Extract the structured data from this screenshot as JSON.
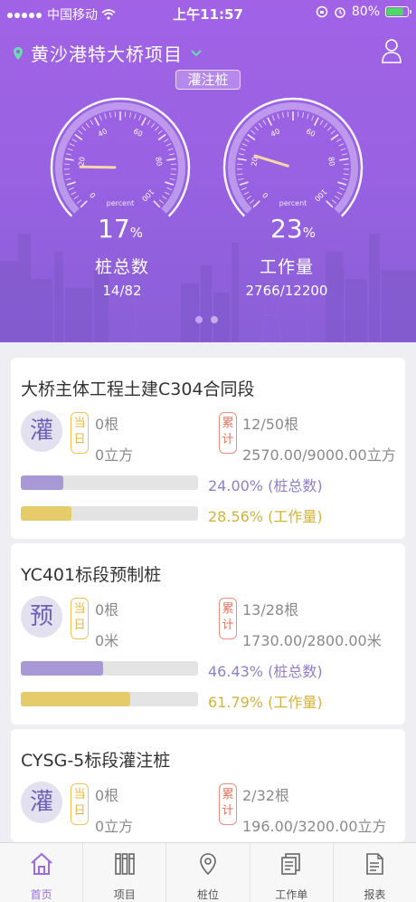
{
  "statusbar": {
    "carrier": "中国移动",
    "time": "上午11:57",
    "battery": "80%"
  },
  "header": {
    "project_title": "黄沙港特大桥项目",
    "mode_tag": "灌注桩"
  },
  "gauges": [
    {
      "percent": "17",
      "unit": "%",
      "label": "percent",
      "name": "桩总数",
      "value": "14/82",
      "fraction": 0.17
    },
    {
      "percent": "23",
      "unit": "%",
      "label": "percent",
      "name": "工作量",
      "value": "2766/12200",
      "fraction": 0.23
    }
  ],
  "gauge_ticks": [
    "0",
    "20",
    "40",
    "60",
    "80",
    "100"
  ],
  "cards": [
    {
      "title": "大桥主体工程土建C304合同段",
      "badge": "灌",
      "today_tag": [
        "当",
        "日"
      ],
      "today_count": "0根",
      "today_amount": "0立方",
      "acc_tag": [
        "累",
        "计"
      ],
      "acc_count": "12/50根",
      "acc_amount": "2570.00/9000.00立方",
      "progress_pile": {
        "fraction": 0.24,
        "text": "24.00% (桩总数)"
      },
      "progress_work": {
        "fraction": 0.2856,
        "text": "28.56% (工作量)"
      }
    },
    {
      "title": "YC401标段预制桩",
      "badge": "预",
      "today_tag": [
        "当",
        "日"
      ],
      "today_count": "0根",
      "today_amount": "0米",
      "acc_tag": [
        "累",
        "计"
      ],
      "acc_count": "13/28根",
      "acc_amount": "1730.00/2800.00米",
      "progress_pile": {
        "fraction": 0.4643,
        "text": "46.43% (桩总数)"
      },
      "progress_work": {
        "fraction": 0.6179,
        "text": "61.79% (工作量)"
      }
    },
    {
      "title": "CYSG-5标段灌注桩",
      "badge": "灌",
      "today_tag": [
        "当",
        "日"
      ],
      "today_count": "0根",
      "today_amount": "0立方",
      "acc_tag": [
        "累",
        "计"
      ],
      "acc_count": "2/32根",
      "acc_amount": "196.00/3200.00立方"
    }
  ],
  "tabs": [
    {
      "label": "首页",
      "icon": "home-icon",
      "active": true
    },
    {
      "label": "项目",
      "icon": "project-icon",
      "active": false
    },
    {
      "label": "桩位",
      "icon": "location-pin-icon",
      "active": false
    },
    {
      "label": "工作单",
      "icon": "worksheet-icon",
      "active": false
    },
    {
      "label": "报表",
      "icon": "report-icon",
      "active": false
    }
  ],
  "colors": {
    "accent_purple": "#9b6be0",
    "progress_purple": "#a898d6",
    "progress_yellow": "#e5cb6a",
    "tag_today": "#f2c351",
    "tag_accumulated": "#ef8d7a"
  }
}
